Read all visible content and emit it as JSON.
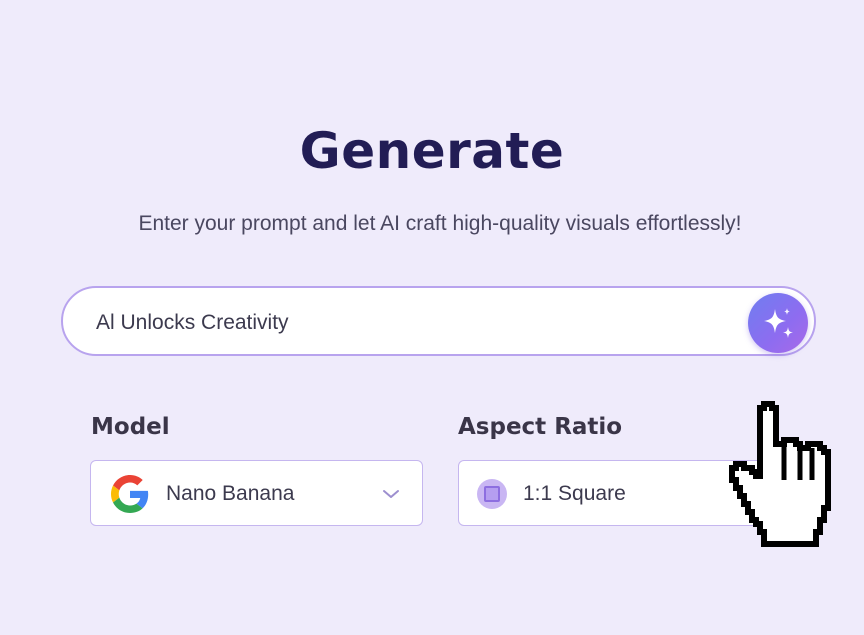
{
  "header": {
    "title": "Generate",
    "subtitle": "Enter your prompt and let AI craft high-quality visuals effortlessly!"
  },
  "prompt": {
    "value": "Al Unlocks Creativity",
    "button_icon": "sparkle-icon"
  },
  "model": {
    "label": "Model",
    "selected": "Nano Banana",
    "icon": "google-g-icon"
  },
  "aspect_ratio": {
    "label": "Aspect Ratio",
    "selected": "1:1 Square",
    "icon": "square-ratio-icon"
  },
  "colors": {
    "background": "#efebfb",
    "title": "#221d55",
    "accent": "#8e6cf0",
    "border": "#b8a3ee"
  },
  "overlay": {
    "cursor_icon": "hand-pointer-cursor-icon"
  }
}
